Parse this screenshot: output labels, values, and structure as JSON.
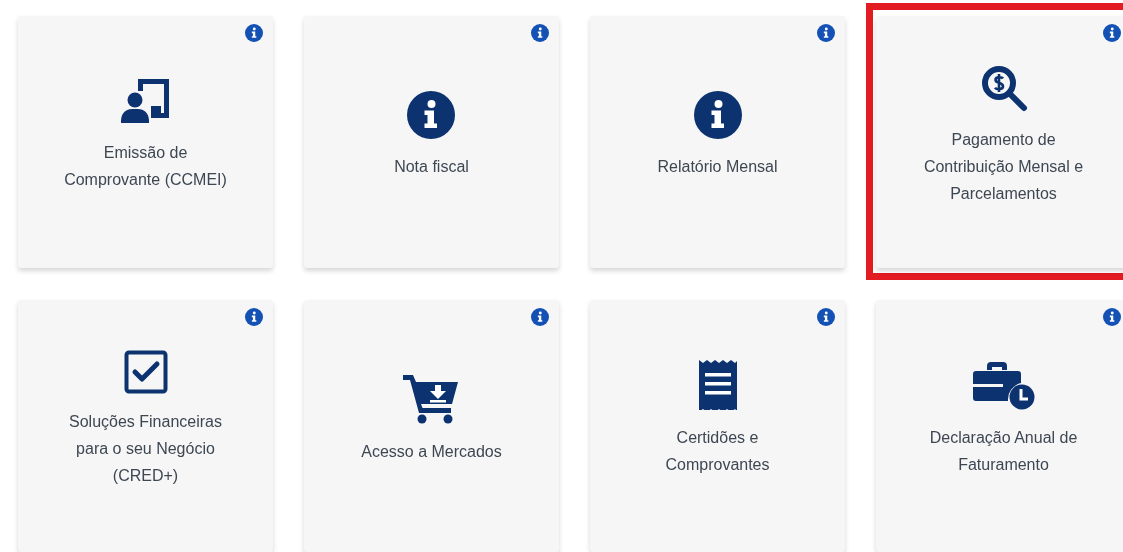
{
  "services": [
    {
      "label": "Emissão de Comprovante (CCMEI)",
      "kind": "presentation",
      "highlighted": false
    },
    {
      "label": "Nota fiscal",
      "kind": "info",
      "highlighted": false
    },
    {
      "label": "Relatório Mensal",
      "kind": "info",
      "highlighted": false
    },
    {
      "label": "Pagamento de Contribuição Mensal e Parcelamentos",
      "kind": "dollar-search",
      "highlighted": true
    },
    {
      "label": "Soluções Financeiras para o seu Negócio (CRED+)",
      "kind": "checkbox",
      "highlighted": false
    },
    {
      "label": "Acesso a Mercados",
      "kind": "cart",
      "highlighted": false
    },
    {
      "label": "Certidões e Comprovantes",
      "kind": "receipt",
      "highlighted": false
    },
    {
      "label": "Declaração Anual de Faturamento",
      "kind": "briefcase-clock",
      "highlighted": false
    }
  ]
}
